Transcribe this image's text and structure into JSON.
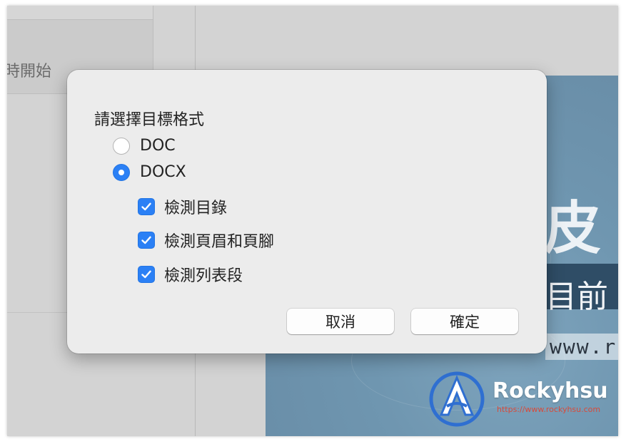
{
  "background_app": {
    "left_panel_text": "時開始"
  },
  "ad_banner": {
    "big_text": "皮 v",
    "mid_text": "目前",
    "url_text": "www.ro",
    "brand": "Rockyhsu",
    "brand_url": "https://www.rockyhsu.com",
    "logo_icon": "rockyhsu-logo-icon"
  },
  "dialog": {
    "title": "請選擇目標格式",
    "format_options": [
      {
        "label": "DOC",
        "selected": false
      },
      {
        "label": "DOCX",
        "selected": true
      }
    ],
    "checkboxes": [
      {
        "label": "檢測目錄",
        "checked": true
      },
      {
        "label": "檢測頁眉和頁腳",
        "checked": true
      },
      {
        "label": "檢測列表段",
        "checked": true
      }
    ],
    "cancel_label": "取消",
    "confirm_label": "確定"
  },
  "colors": {
    "accent": "#2b80f5",
    "dialog_bg": "#ececec",
    "window_bg": "#d3d3d3",
    "ad_bg": "#6f96b0"
  }
}
